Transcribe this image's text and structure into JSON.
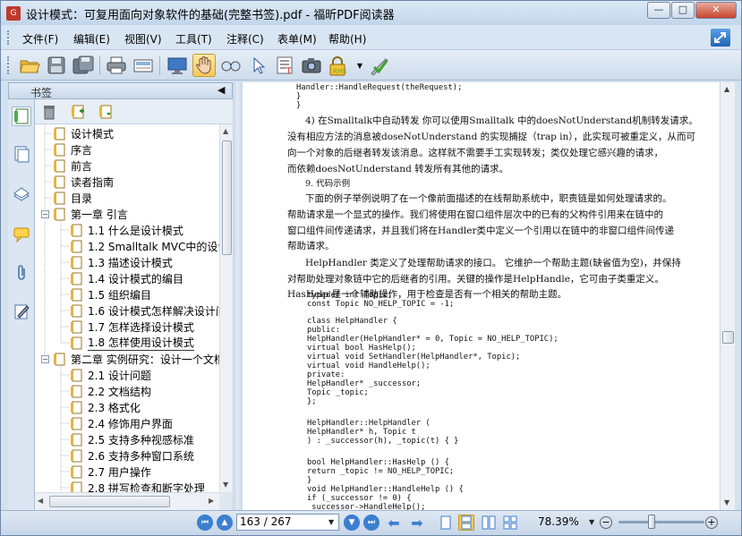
{
  "window": {
    "title": "设计模式：可复用面向对象软件的基础(完整书签).pdf - 福昕PDF阅读器",
    "minimize": "—",
    "maximize": "□",
    "close": "✕"
  },
  "menu": [
    {
      "label": "文件(F)"
    },
    {
      "label": "编辑(E)"
    },
    {
      "label": "视图(V)"
    },
    {
      "label": "工具(T)"
    },
    {
      "label": "注释(C)"
    },
    {
      "label": "表单(M)"
    },
    {
      "label": "帮助(H)"
    }
  ],
  "toolbar_icons": [
    "open-folder",
    "save",
    "save-as",
    "print",
    "scan",
    "full-screen",
    "hand-tool",
    "zoom-glass",
    "select-arrow",
    "text-select",
    "snapshot",
    "rms",
    "sign-pen"
  ],
  "toolbar_rms_label": "RMS",
  "sidebar": {
    "title": "书签",
    "collapse_arrow": "◀",
    "bookmarks": [
      {
        "label": "设计模式",
        "level": 0,
        "expander": ""
      },
      {
        "label": "序言",
        "level": 0,
        "expander": ""
      },
      {
        "label": "前言",
        "level": 0,
        "expander": ""
      },
      {
        "label": "读者指南",
        "level": 0,
        "expander": ""
      },
      {
        "label": "目录",
        "level": 0,
        "expander": ""
      },
      {
        "label": "第一章 引言",
        "level": 0,
        "expander": "−"
      },
      {
        "label": "1.1 什么是设计模式",
        "level": 1,
        "expander": ""
      },
      {
        "label": "1.2 Smalltalk MVC中的设计",
        "level": 1,
        "expander": ""
      },
      {
        "label": "1.3 描述设计模式",
        "level": 1,
        "expander": ""
      },
      {
        "label": "1.4 设计模式的编目",
        "level": 1,
        "expander": ""
      },
      {
        "label": "1.5 组织编目",
        "level": 1,
        "expander": ""
      },
      {
        "label": "1.6 设计模式怎样解决设计问",
        "level": 1,
        "expander": ""
      },
      {
        "label": "1.7 怎样选择设计模式",
        "level": 1,
        "expander": ""
      },
      {
        "label": "1.8 怎样使用设计模式",
        "level": 1,
        "expander": ""
      },
      {
        "label": "第二章 实例研究：设计一个文档",
        "level": 0,
        "expander": "−"
      },
      {
        "label": "2.1 设计问题",
        "level": 1,
        "expander": ""
      },
      {
        "label": "2.2 文档结构",
        "level": 1,
        "expander": ""
      },
      {
        "label": "2.3 格式化",
        "level": 1,
        "expander": ""
      },
      {
        "label": "2.4 修饰用户界面",
        "level": 1,
        "expander": ""
      },
      {
        "label": "2.5 支持多种视感标准",
        "level": 1,
        "expander": ""
      },
      {
        "label": "2.6 支持多种窗口系统",
        "level": 1,
        "expander": ""
      },
      {
        "label": "2.7 用户操作",
        "level": 1,
        "expander": ""
      },
      {
        "label": "2.8 拼写检查和断字处理",
        "level": 1,
        "expander": ""
      }
    ]
  },
  "document": {
    "top_code": [
      "        Handler::HandleRequest(theRequest);",
      "    }",
      "}"
    ],
    "text_lines": [
      "4) 在Smalltalk中自动转发   你可以使用Smalltalk 中的doesNotUnderstand机制转发请求。",
      "没有相应方法的消息被doseNotUnderstand 的实现捕捉（trap in），此实现可被重定义，从而可",
      "向一个对象的后继者转发该消息。这样就不需要手工实现转发；类仅处理它感兴趣的请求，",
      "而依赖doesNotUnderstand 转发所有其他的请求。",
      "9. 代码示例",
      "下面的例子举例说明了在一个像前面描述的在线帮助系统中，职责链是如何处理请求的。",
      "帮助请求是一个显式的操作。我们将使用在窗口组件层次中的已有的父构件引用来在链中的",
      "窗口组件间传递请求，并且我们将在Handler类中定义一个引用以在链中的非窗口组件间传递",
      "帮助请求。",
      "HelpHandler 类定义了处理帮助请求的接口。 它维护一个帮助主题(缺省值为空)，并保持",
      "对帮助处理对象链中它的后继者的引用。关键的操作是HelpHandle，它可由子类重定义。",
      "HasHelp 是一个辅助操作，用于检查是否有一个相关的帮助主题。"
    ],
    "code_lines": [
      "typedef int Topic;",
      "const Topic NO_HELP_TOPIC = -1;",
      "",
      "class HelpHandler {",
      "public:",
      "    HelpHandler(HelpHandler* = 0, Topic = NO_HELP_TOPIC);",
      "    virtual bool HasHelp();",
      "    virtual void SetHandler(HelpHandler*, Topic);",
      "    virtual void HandleHelp();",
      "private:",
      "    HelpHandler* _successor;",
      "    Topic _topic;",
      "};",
      "",
      "HelpHandler::HelpHandler (",
      "    HelpHandler* h, Topic t",
      ") : _successor(h), _topic(t) { }",
      "",
      "bool HelpHandler::HasHelp () {",
      "    return _topic != NO_HELP_TOPIC;",
      "}",
      "void HelpHandler::HandleHelp () {",
      "    if (_successor != 0) {",
      "        _successor->HandleHelp();"
    ]
  },
  "status": {
    "page_field": "163 / 267",
    "zoom_text": "78.39%",
    "zoom_level": 0.39
  }
}
